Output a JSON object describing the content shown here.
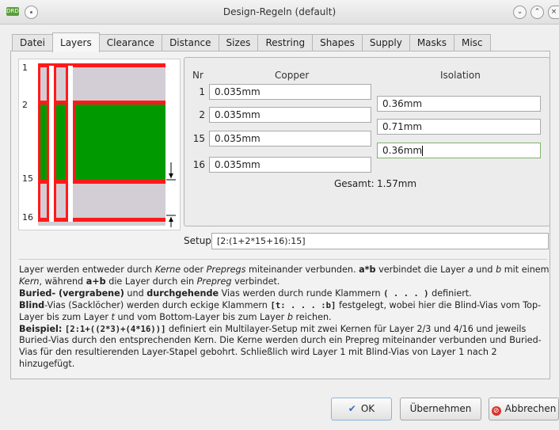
{
  "window": {
    "title": "Design-Regeln (default)",
    "app_icon_text": "DRD",
    "title_menu_icon": "window-menu-icon",
    "controls": [
      "minimize-icon",
      "maximize-icon",
      "close-icon"
    ]
  },
  "tabs": [
    {
      "label": "Datei"
    },
    {
      "label": "Layers",
      "active": true
    },
    {
      "label": "Clearance"
    },
    {
      "label": "Distance"
    },
    {
      "label": "Sizes"
    },
    {
      "label": "Restring"
    },
    {
      "label": "Shapes"
    },
    {
      "label": "Supply"
    },
    {
      "label": "Masks"
    },
    {
      "label": "Misc"
    }
  ],
  "preview": {
    "layer_labels": [
      "1",
      "2",
      "15",
      "16"
    ],
    "colors": {
      "copper": "#ff1a1a",
      "core": "#009900",
      "prepreg": "#d3cdd5",
      "background": "#ffffff"
    }
  },
  "layers": {
    "headers": {
      "nr": "Nr",
      "copper": "Copper",
      "isolation": "Isolation"
    },
    "rows": [
      {
        "nr": "1",
        "copper": "0.035mm"
      },
      {
        "nr": "2",
        "copper": "0.035mm"
      },
      {
        "nr": "15",
        "copper": "0.035mm"
      },
      {
        "nr": "16",
        "copper": "0.035mm"
      }
    ],
    "isolation": [
      "0.36mm",
      "0.71mm",
      "0.36mm"
    ],
    "total_label": "Gesamt:",
    "total_value": "1.57mm"
  },
  "setup": {
    "label": "Setup",
    "value": "[2:(1+2*15+16):15]"
  },
  "help": {
    "p1": {
      "a": "Layer werden entweder durch ",
      "kerne": "Kerne",
      "b": " oder ",
      "prepregs": "Prepregs",
      "c": " miteinander verbunden. ",
      "atb": "a*b",
      "d": " verbindet die Layer ",
      "a_var": "a",
      "e": " und ",
      "b_var": "b",
      "f": " mit einem ",
      "kern": "Kern",
      "g": ", während ",
      "apb": "a+b",
      "h": " die Layer durch ein ",
      "prepreg": "Prepreg",
      "i": " verbindet."
    },
    "p2": {
      "buried": "Buried-",
      "vergrabene": " (vergrabene)",
      "und": " und ",
      "durch": "durchgehende",
      "text1": " Vias werden durch runde Klammern ",
      "code": "( . . . )",
      "text2": " definiert."
    },
    "p3": {
      "blind": "Blind",
      "text1": "-Vias (Sacklöcher) werden durch eckige Klammern ",
      "code": "[t: . . . :b]",
      "text2": " festgelegt, wobei hier die Blind-Vias vom Top-Layer bis zum Layer ",
      "t_var": "t",
      "text3": " und vom Bottom-Layer bis zum Layer ",
      "b_var": "b",
      "text4": " reichen."
    },
    "p4": {
      "beispiel": "Beispiel:",
      "code": "[2:1+((2*3)+(4*16))]",
      "text": " definiert ein Multilayer-Setup mit zwei Kernen für Layer 2/3 und 4/16 und jeweils Buried-Vias durch den entsprechenden Kern. Die Kerne werden durch ein Prepreg miteinander verbunden und Buried-Vias für den resultierenden Layer-Stapel gebohrt. Schließlich wird Layer 1 mit Blind-Vias von Layer 1 nach 2 hinzugefügt."
    }
  },
  "buttons": {
    "ok": "OK",
    "ok_icon": "checkmark-icon",
    "apply": "Übernehmen",
    "cancel": "Abbrechen",
    "cancel_icon": "cancel-icon"
  }
}
